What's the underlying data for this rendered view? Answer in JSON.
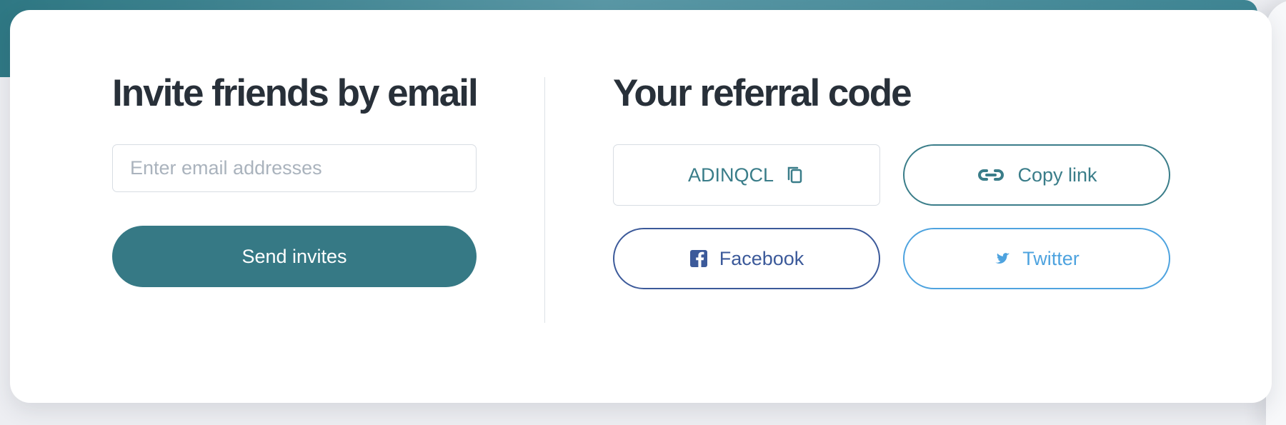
{
  "invite": {
    "title": "Invite friends by email",
    "email_placeholder": "Enter email addresses",
    "email_value": "",
    "send_button_label": "Send invites"
  },
  "referral": {
    "title": "Your referral code",
    "code": "ADINQCL",
    "code_icon": "copy-icon",
    "copy_link_label": "Copy link",
    "copy_link_icon": "link-icon",
    "facebook_label": "Facebook",
    "facebook_icon": "facebook-icon",
    "twitter_label": "Twitter",
    "twitter_icon": "twitter-icon"
  },
  "colors": {
    "banner": "#367985",
    "primary": "#367985",
    "title_text": "#283039",
    "input_placeholder": "#aab3bd",
    "copy_link": "#3a7d89",
    "facebook": "#3c5a9a",
    "twitter": "#4ea3df"
  }
}
